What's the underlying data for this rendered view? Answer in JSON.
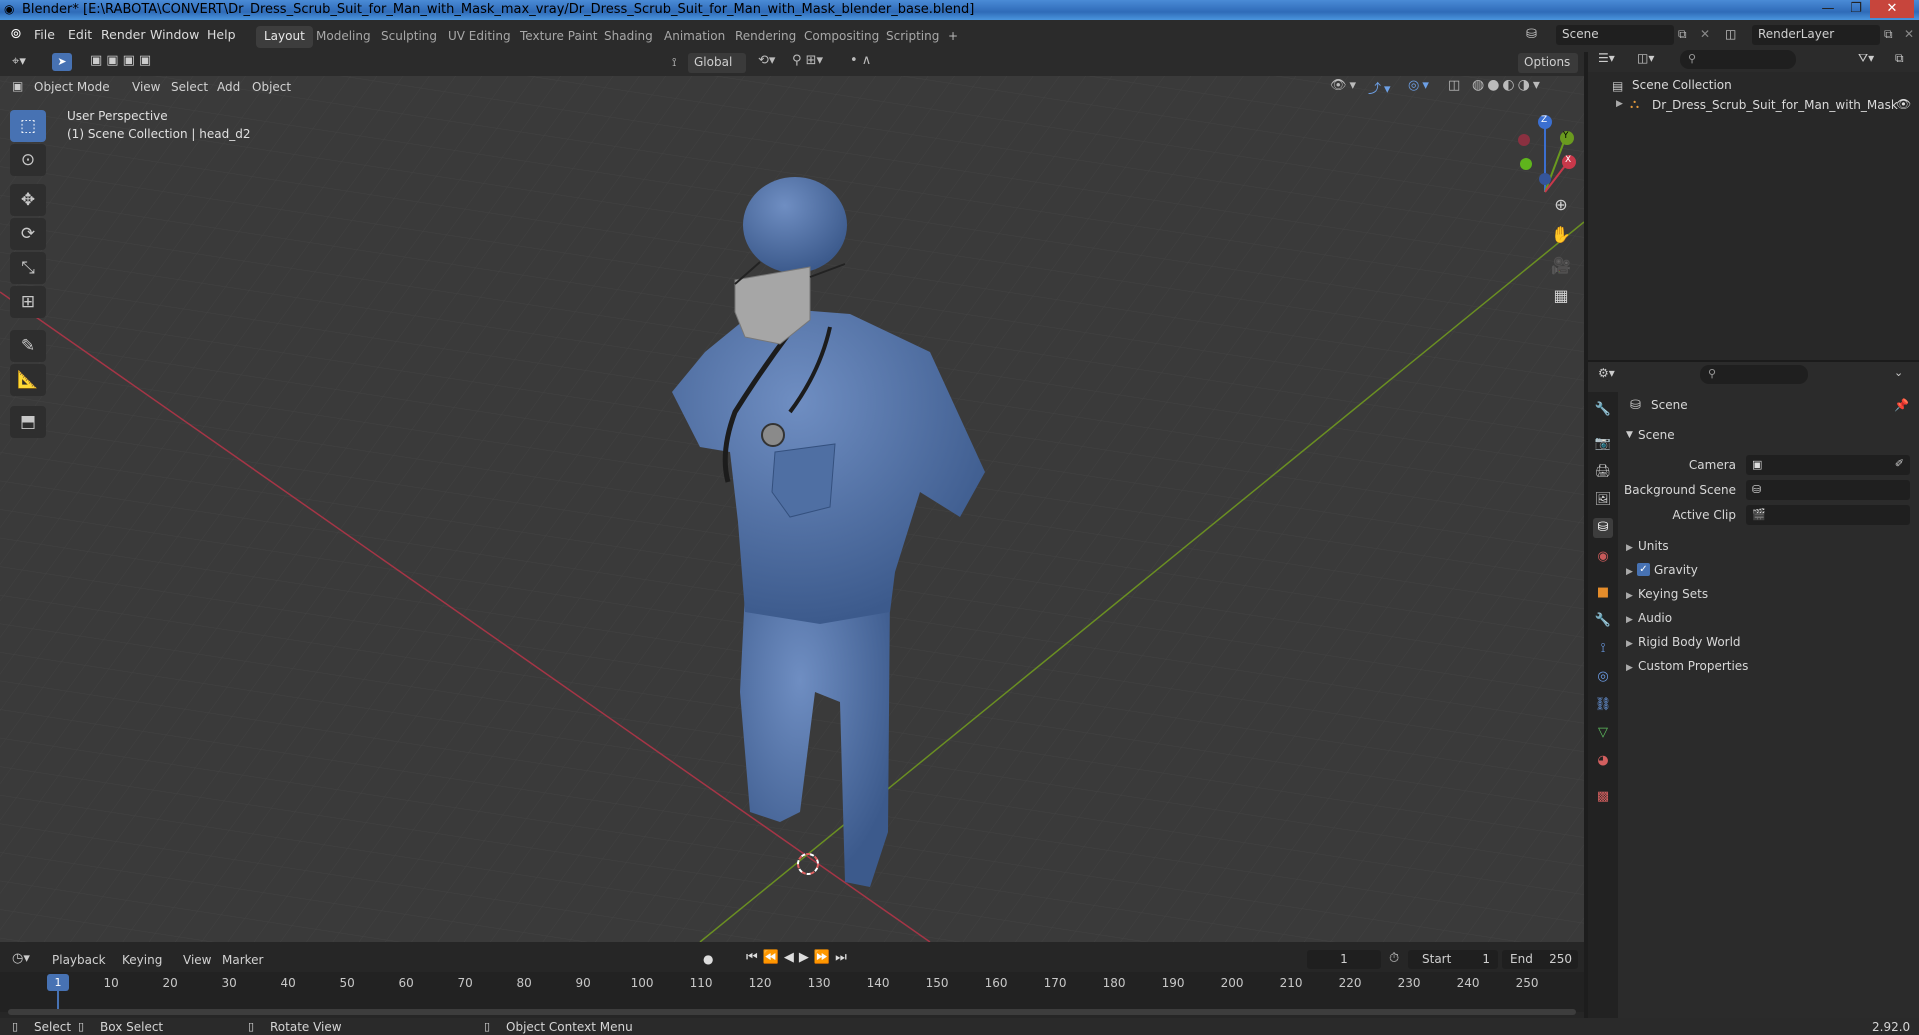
{
  "window": {
    "title": "Blender* [E:\\RABOTA\\CONVERT\\Dr_Dress_Scrub_Suit_for_Man_with_Mask_max_vray/Dr_Dress_Scrub_Suit_for_Man_with_Mask_blender_base.blend]"
  },
  "menubar": {
    "items": [
      "File",
      "Edit",
      "Render",
      "Window",
      "Help"
    ],
    "workspaces": [
      "Layout",
      "Modeling",
      "Sculpting",
      "UV Editing",
      "Texture Paint",
      "Shading",
      "Animation",
      "Rendering",
      "Compositing",
      "Scripting"
    ],
    "add_tab": "+",
    "scene_name": "Scene",
    "render_layer": "RenderLayer"
  },
  "viewport_header": {
    "transform_orientation": "Global",
    "options": "Options",
    "mode": "Object Mode",
    "menus": [
      "View",
      "Select",
      "Add",
      "Object"
    ]
  },
  "viewport": {
    "perspective": "User Perspective",
    "collection_info": "(1) Scene Collection | head_d2",
    "gizmo_axes": [
      "Z",
      "Y",
      "X"
    ]
  },
  "outliner": {
    "root": "Scene Collection",
    "items": [
      "Dr_Dress_Scrub_Suit_for_Man_with_Mask"
    ]
  },
  "properties": {
    "context": "Scene",
    "panel": "Scene",
    "fields": [
      {
        "label": "Camera",
        "value": ""
      },
      {
        "label": "Background Scene",
        "value": ""
      },
      {
        "label": "Active Clip",
        "value": ""
      }
    ],
    "subpanels": [
      "Units",
      "Gravity",
      "Keying Sets",
      "Audio",
      "Rigid Body World",
      "Custom Properties"
    ],
    "gravity_checked": true
  },
  "timeline": {
    "menus": [
      "Playback",
      "Keying",
      "View",
      "Marker"
    ],
    "current_frame": "1",
    "start_label": "Start",
    "start": "1",
    "end_label": "End",
    "end": "250",
    "ticks": [
      "10",
      "20",
      "30",
      "40",
      "50",
      "60",
      "70",
      "80",
      "90",
      "100",
      "110",
      "120",
      "130",
      "140",
      "150",
      "160",
      "170",
      "180",
      "190",
      "200",
      "210",
      "220",
      "230",
      "240",
      "250"
    ],
    "playhead": "1"
  },
  "statusbar": {
    "items": [
      "Select",
      "Box Select",
      "Rotate View",
      "Object Context Menu"
    ],
    "version": "2.92.0"
  },
  "colors": {
    "accent": "#4772b3",
    "x_axis": "#c8384a",
    "y_axis": "#6c9a1f",
    "scrubs": "#4a6a9e"
  }
}
